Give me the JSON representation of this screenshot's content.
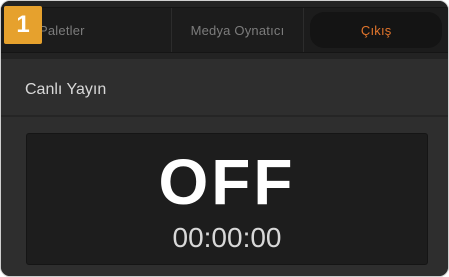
{
  "step_badge": "1",
  "tabs": [
    {
      "label": "Paletler",
      "active": false
    },
    {
      "label": "Medya Oynatıcı",
      "active": false
    },
    {
      "label": "Çıkış",
      "active": true
    }
  ],
  "section": {
    "title": "Canlı Yayın"
  },
  "live_stream": {
    "status": "OFF",
    "duration": "00:00:00"
  },
  "colors": {
    "accent": "#e2752c",
    "badge": "#e6a12d"
  }
}
